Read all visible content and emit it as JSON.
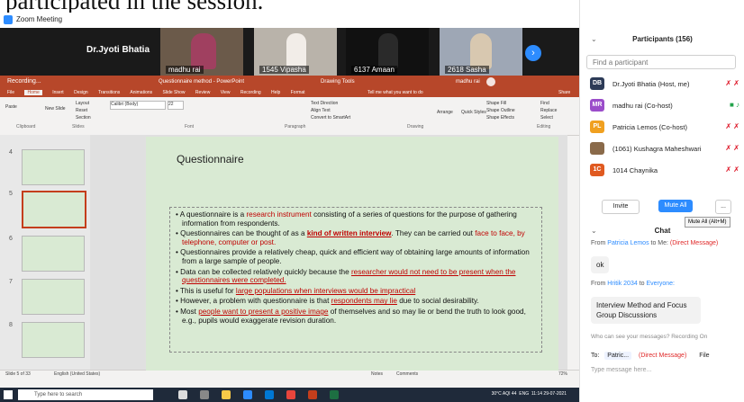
{
  "caption": "participated in the session.",
  "window": {
    "title": "Zoom Meeting",
    "min": "–",
    "max": "☐",
    "close": "✕"
  },
  "video": {
    "active_speaker": "Dr.Jyoti Bhatia",
    "tiles": [
      "madhu rai",
      "1545 Vipasha",
      "6137 Amaan",
      "2618 Sasha"
    ]
  },
  "ppt": {
    "recording": "Recording...",
    "title": "Questionnaire method - PowerPoint",
    "drawing_tools": "Drawing Tools",
    "user": "madhu rai",
    "tabs": [
      "File",
      "Home",
      "Insert",
      "Design",
      "Transitions",
      "Animations",
      "Slide Show",
      "Review",
      "View",
      "Recording",
      "Help",
      "Format"
    ],
    "tell_me": "Tell me what you want to do",
    "share": "Share",
    "font": "Calibri (Body)",
    "size": "22",
    "groups": [
      "Clipboard",
      "Slides",
      "Font",
      "Paragraph",
      "Drawing",
      "Editing"
    ],
    "ribbon_items": [
      "Layout",
      "Reset",
      "Section",
      "New Slide",
      "Paste",
      "Text Direction",
      "Align Text",
      "Convert to SmartArt",
      "Arrange",
      "Quick Styles",
      "Shape Fill",
      "Shape Outline",
      "Shape Effects",
      "Find",
      "Replace",
      "Select"
    ],
    "thumb_numbers": [
      "4",
      "5",
      "6",
      "7",
      "8"
    ],
    "slide": {
      "title": "Questionnaire",
      "b1a": "A questionnaire is a ",
      "b1r": "research instrument",
      "b1b": " consisting of a series of questions for the purpose of gathering information from respondents.",
      "b2a": "Questionnaires can be thought of as a ",
      "b2r": "kind of written interview",
      "b2b": ". They can be carried out ",
      "b2r2": "face to face, by telephone, computer or post.",
      "b3": "Questionnaires provide a relatively cheap, quick and efficient way of obtaining large amounts of information from a large sample of people.",
      "b4a": "Data can be collected relatively quickly because the ",
      "b4r": "researcher would not need to be present when the questionnaires were completed.",
      "b5a": "This is useful for ",
      "b5r": "large populations when interviews would be impractical",
      "b6a": "However, a problem with questionnaire is that ",
      "b6r": "respondents may lie",
      "b6b": " due to social desirability.",
      "b7a": "Most ",
      "b7r": "people want to present a positive image",
      "b7b": " of themselves and so may lie or bend the truth to look good, e.g., pupils would exaggerate revision duration."
    },
    "status": {
      "slide": "Slide 5 of 33",
      "lang": "English (United States)",
      "notes": "Notes",
      "comments": "Comments",
      "zoom": "72%"
    }
  },
  "taskbar": {
    "search": "Type here to search",
    "weather": "30°C AQI 44",
    "lang": "ENG",
    "time": "11:14",
    "date": "29-07-2021"
  },
  "participants": {
    "title": "Participants (156)",
    "find": "Find a participant",
    "list": [
      {
        "initials": "DB",
        "name": "Dr.Jyoti Bhatia (Host, me)",
        "color": "#2d3b57"
      },
      {
        "initials": "MR",
        "name": "madhu rai (Co-host)",
        "color": "#9b4dca"
      },
      {
        "initials": "PL",
        "name": "Patricia Lemos (Co-host)",
        "color": "#f0a020"
      },
      {
        "initials": "",
        "name": "(1061) Kushagra Maheshwari",
        "color": "#8a6a4a"
      },
      {
        "initials": "1C",
        "name": "1014 Chaynika",
        "color": "#e05a20"
      }
    ],
    "invite": "Invite",
    "mute_all": "Mute All",
    "more": "...",
    "tooltip": "Mute All (Alt+M)"
  },
  "chat": {
    "title": "Chat",
    "m1_from": "From ",
    "m1_name": "Patricia Lemos",
    "m1_to": " to Me: ",
    "m1_dm": "(Direct Message)",
    "m1_text": "ok",
    "m2_from": "From ",
    "m2_name": "Hritik 2034",
    "m2_to": " to ",
    "m2_everyone": "Everyone:",
    "m2_text": "Interview Method and Focus Group Discussions",
    "who_can": "Who can see your messages? Recording On",
    "to_label": "To:",
    "to_name": "Patric...",
    "to_dm": "(Direct Message)",
    "file": "File",
    "placeholder": "Type message here..."
  }
}
